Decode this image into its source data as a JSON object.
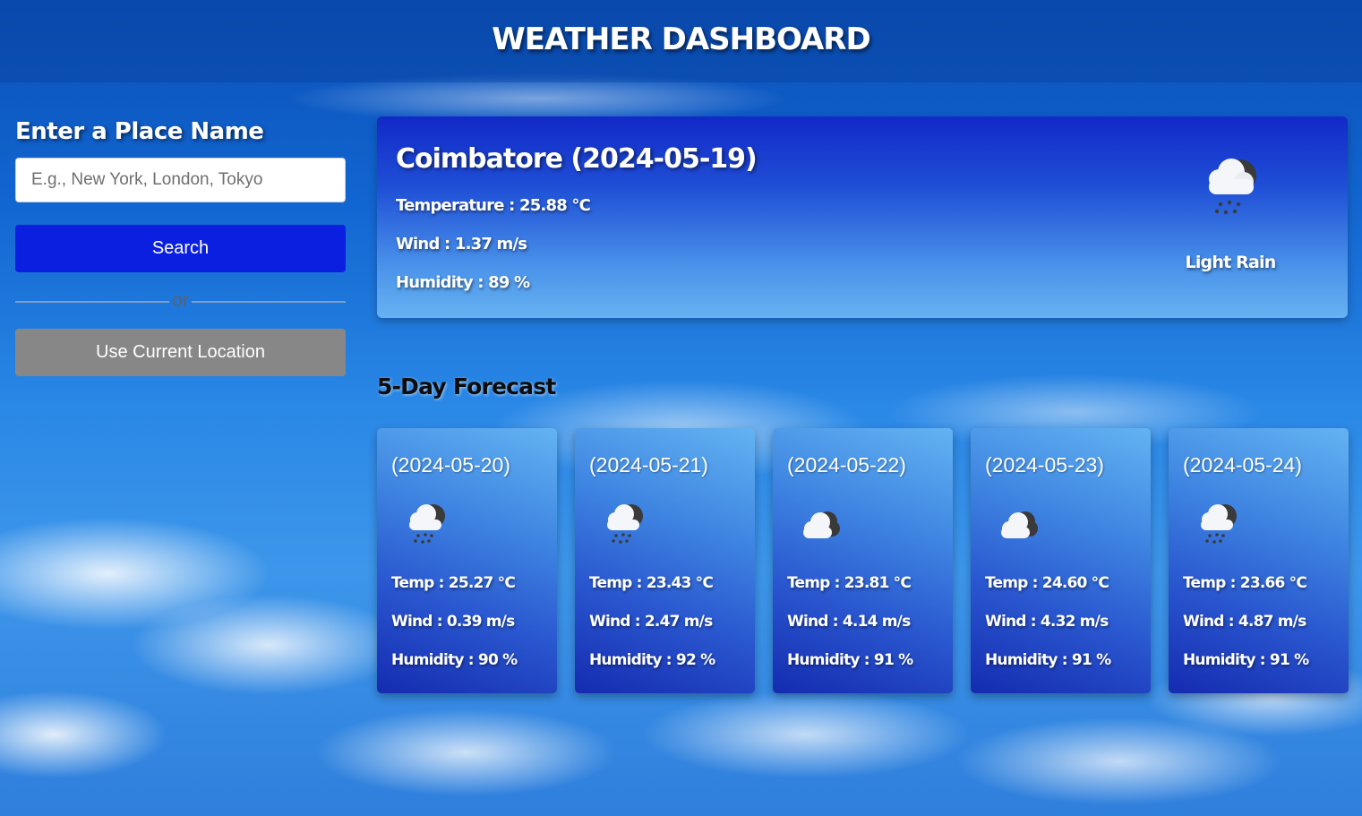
{
  "header": {
    "title": "WEATHER DASHBOARD"
  },
  "search_panel": {
    "label": "Enter a Place Name",
    "input_placeholder": "E.g., New York, London, Tokyo",
    "input_value": "",
    "search_label": "Search",
    "or_text": "or",
    "location_label": "Use Current Location"
  },
  "current": {
    "title": "Coimbatore (2024-05-19)",
    "temperature": "Temperature : 25.88 °C",
    "wind": "Wind : 1.37 m/s",
    "humidity": "Humidity : 89 %",
    "description": "Light Rain",
    "icon": "rain-cloud-icon"
  },
  "forecast": {
    "title": "5-Day Forecast",
    "days": [
      {
        "date": "(2024-05-20)",
        "icon": "rain-cloud-icon",
        "temp": "Temp : 25.27 °C",
        "wind": "Wind : 0.39 m/s",
        "humidity": "Humidity : 90 %"
      },
      {
        "date": "(2024-05-21)",
        "icon": "rain-cloud-icon",
        "temp": "Temp : 23.43 °C",
        "wind": "Wind : 2.47 m/s",
        "humidity": "Humidity : 92 %"
      },
      {
        "date": "(2024-05-22)",
        "icon": "overcast-cloud-icon",
        "temp": "Temp : 23.81 °C",
        "wind": "Wind : 4.14 m/s",
        "humidity": "Humidity : 91 %"
      },
      {
        "date": "(2024-05-23)",
        "icon": "overcast-cloud-icon",
        "temp": "Temp : 24.60 °C",
        "wind": "Wind : 4.32 m/s",
        "humidity": "Humidity : 91 %"
      },
      {
        "date": "(2024-05-24)",
        "icon": "rain-cloud-icon",
        "temp": "Temp : 23.66 °C",
        "wind": "Wind : 4.87 m/s",
        "humidity": "Humidity : 91 %"
      }
    ]
  },
  "colors": {
    "search_button": "#0a1fe0",
    "location_button": "#878787",
    "card_top": "#1229c8",
    "card_bottom": "#67b2f2"
  }
}
